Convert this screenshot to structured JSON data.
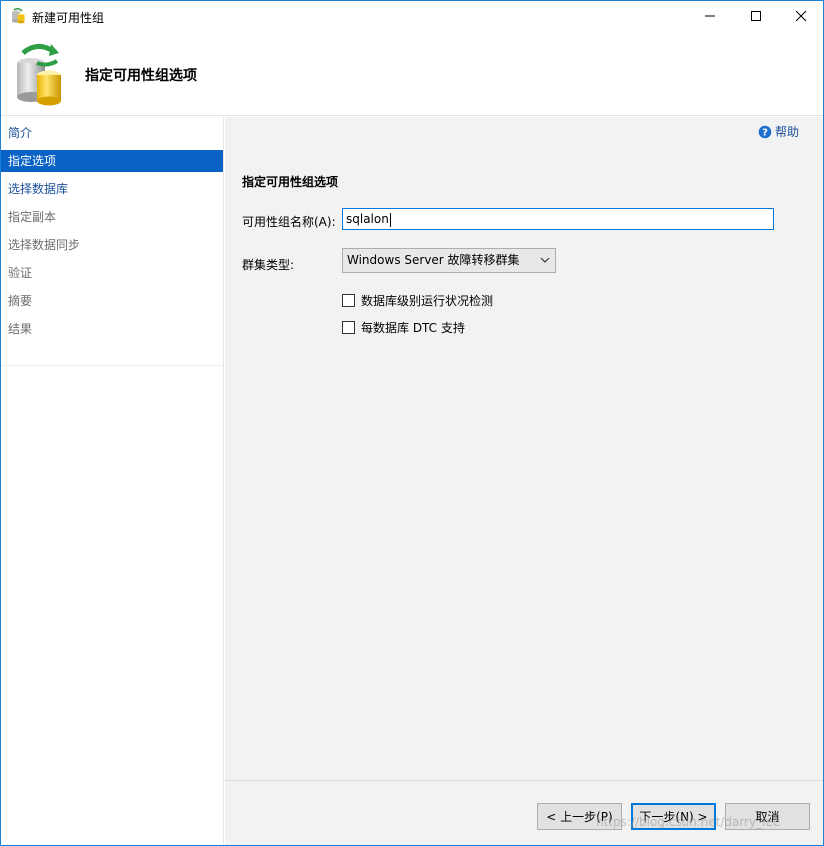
{
  "window": {
    "title": "新建可用性组"
  },
  "header": {
    "title": "指定可用性组选项"
  },
  "sidebar": {
    "items": [
      {
        "label": "简介",
        "state": "link"
      },
      {
        "label": "指定选项",
        "state": "selected"
      },
      {
        "label": "选择数据库",
        "state": "link"
      },
      {
        "label": "指定副本",
        "state": "disabled"
      },
      {
        "label": "选择数据同步",
        "state": "disabled"
      },
      {
        "label": "验证",
        "state": "disabled"
      },
      {
        "label": "摘要",
        "state": "disabled"
      },
      {
        "label": "结果",
        "state": "disabled"
      }
    ]
  },
  "content": {
    "help_label": "帮助",
    "section_title": "指定可用性组选项",
    "name_label": "可用性组名称(A):",
    "name_value": "sqlalon",
    "cluster_label": "群集类型:",
    "cluster_value": "Windows Server 故障转移群集",
    "checkbox_health": "数据库级别运行状况检测",
    "checkbox_dtc": "每数据库 DTC 支持"
  },
  "footer": {
    "prev_label": "< 上一步(P)",
    "next_label": "下一步(N) >",
    "cancel_label": "取消"
  },
  "watermark": "https://blog.csdn.net/darry_lee",
  "colors": {
    "accent": "#0078d7",
    "selected_nav": "#0a62c7",
    "link": "#1b4f9c"
  },
  "icons": {
    "app": "database-availability-icon",
    "help": "help-circle-icon"
  }
}
